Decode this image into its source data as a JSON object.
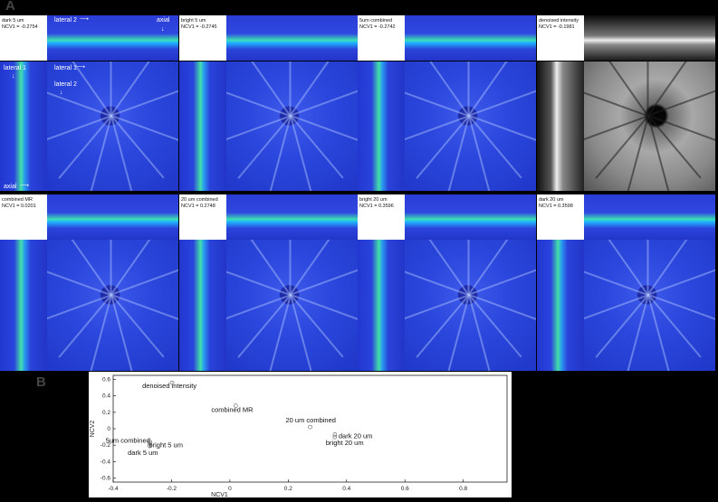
{
  "figure": {
    "panel_a_label": "A",
    "panel_b_label": "B"
  },
  "panels": [
    {
      "name": "dark 5 um",
      "ncv": "NCV1 = -0.2754"
    },
    {
      "name": "bright 5 um",
      "ncv": "NCV1 = -0.2745"
    },
    {
      "name": "5um combined",
      "ncv": "NCV1 = -0.2742"
    },
    {
      "name": "denoised intensity",
      "ncv": "NCV1 = -0.1981"
    },
    {
      "name": "combined MR",
      "ncv": "NCV1 = 0.0201"
    },
    {
      "name": "20 um combined",
      "ncv": "NCV1 = 0.2748"
    },
    {
      "name": "bright 20 um",
      "ncv": "NCV1 = 0.3596"
    },
    {
      "name": "dark 20 um",
      "ncv": "NCV1 = 0.3598"
    }
  ],
  "annotations": {
    "lateral2_top": "lateral 2",
    "axial_top": "axial",
    "lateral1_side": "lateral 1",
    "axial_side": "axial",
    "lateral1_en": "lateral 1",
    "lateral2_en": "lateral 2"
  },
  "colors": {
    "colormap_low": "#2235c8",
    "colormap_high": "#44e0a8",
    "grayscale_panel": "#8a8a8a"
  },
  "chart_data": {
    "type": "scatter",
    "xlabel": "NCV1",
    "ylabel": "NCV2",
    "xlim": [
      -0.4,
      0.95
    ],
    "ylim": [
      -0.65,
      0.65
    ],
    "xticks": [
      "-0.4",
      "-0.2",
      "0",
      "0.2",
      "0.4",
      "0.6",
      "0.8"
    ],
    "yticks": [
      "0.6",
      "0.4",
      "0.2",
      "0",
      "-0.2",
      "-0.4",
      "-0.6"
    ],
    "points": [
      {
        "label": "denoised intensity",
        "x": -0.198,
        "y": 0.56
      },
      {
        "label": "combined MR",
        "x": 0.02,
        "y": 0.28
      },
      {
        "label": "20 um combined",
        "x": 0.275,
        "y": 0.02
      },
      {
        "label": "dark 20 um",
        "x": 0.36,
        "y": -0.07
      },
      {
        "label": "bright 20 um",
        "x": 0.36,
        "y": -0.1
      },
      {
        "label": "5um combined",
        "x": -0.274,
        "y": -0.16
      },
      {
        "label": "bright 5 um",
        "x": -0.2745,
        "y": -0.18
      },
      {
        "label": "dark 5 um",
        "x": -0.2754,
        "y": -0.21
      }
    ]
  }
}
